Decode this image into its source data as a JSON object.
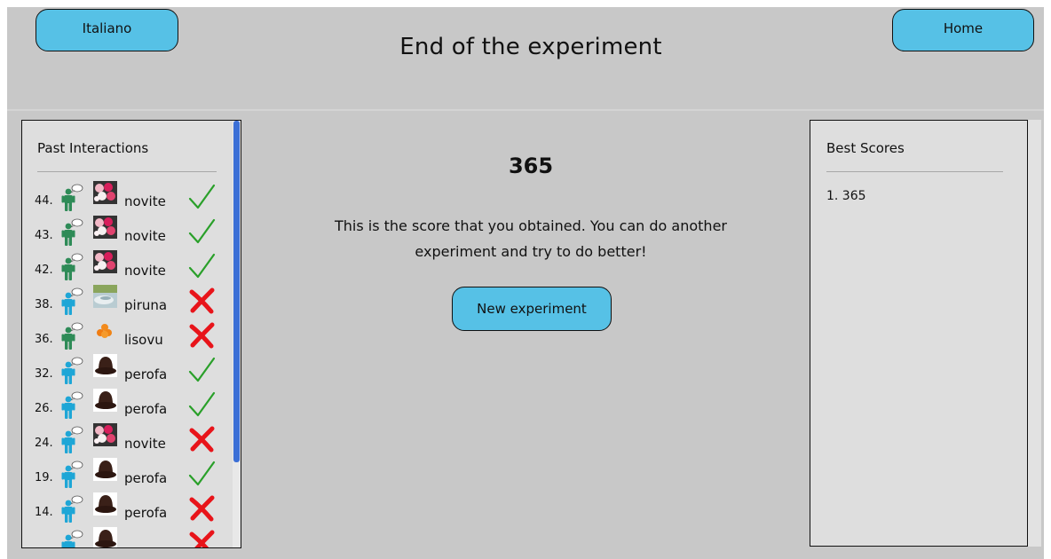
{
  "header": {
    "language_button": "Italiano",
    "home_button": "Home",
    "title": "End of the experiment"
  },
  "past_interactions": {
    "title": "Past Interactions",
    "rows": [
      {
        "num": "44.",
        "speaker": "green",
        "object": "flowers",
        "word": "novite",
        "result": "correct"
      },
      {
        "num": "43.",
        "speaker": "green",
        "object": "flowers",
        "word": "novite",
        "result": "correct"
      },
      {
        "num": "42.",
        "speaker": "green",
        "object": "flowers",
        "word": "novite",
        "result": "correct"
      },
      {
        "num": "38.",
        "speaker": "blue",
        "object": "water",
        "word": "piruna",
        "result": "wrong"
      },
      {
        "num": "36.",
        "speaker": "green",
        "object": "oranges",
        "word": "lisovu",
        "result": "wrong"
      },
      {
        "num": "32.",
        "speaker": "blue",
        "object": "hat",
        "word": "perofa",
        "result": "correct"
      },
      {
        "num": "26.",
        "speaker": "blue",
        "object": "hat",
        "word": "perofa",
        "result": "correct"
      },
      {
        "num": "24.",
        "speaker": "blue",
        "object": "flowers",
        "word": "novite",
        "result": "wrong"
      },
      {
        "num": "19.",
        "speaker": "blue",
        "object": "hat",
        "word": "perofa",
        "result": "correct"
      },
      {
        "num": "14.",
        "speaker": "blue",
        "object": "hat",
        "word": "perofa",
        "result": "wrong"
      },
      {
        "num": "",
        "speaker": "blue",
        "object": "hat",
        "word": "",
        "result": "wrong"
      }
    ]
  },
  "center": {
    "score": "365",
    "message": "This is the score that you obtained. You can do another experiment and try to do better!",
    "new_button": "New experiment"
  },
  "best_scores": {
    "title": "Best Scores",
    "items": [
      "1. 365"
    ]
  },
  "colors": {
    "button": "#56c1e6",
    "background": "#c8c8c8",
    "panel": "#dedede",
    "speaker_green": "#2e8b57",
    "speaker_blue": "#1ea6d6",
    "check": "#2aa02a",
    "cross": "#e8141a",
    "scroll_thumb": "#3b6fd6"
  }
}
